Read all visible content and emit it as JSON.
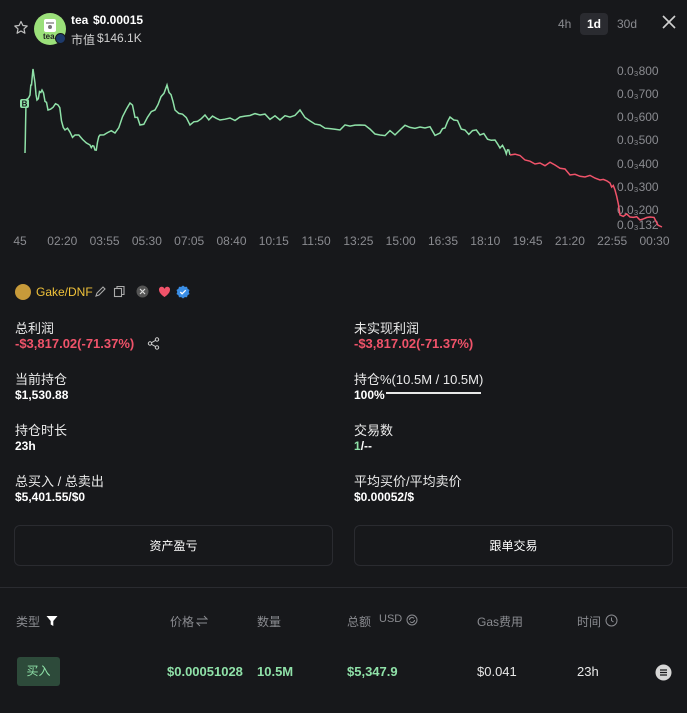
{
  "token": {
    "name": "tea",
    "price": "$0.00015",
    "market_cap_label": "市值",
    "market_cap": "$146.1K",
    "avatar_text": "tea"
  },
  "timeframes": [
    "4h",
    "1d",
    "30d"
  ],
  "active_timeframe": "1d",
  "chart_data": {
    "type": "line",
    "x_ticks": [
      "45",
      "02:20",
      "03:55",
      "05:30",
      "07:05",
      "08:40",
      "10:15",
      "11:50",
      "13:25",
      "15:00",
      "16:35",
      "18:10",
      "19:45",
      "21:20",
      "22:55",
      "00:30"
    ],
    "y_ticks": [
      "0.0₃800",
      "0.0₃700",
      "0.0₃600",
      "0.0₃500",
      "0.0₃400",
      "0.0₃300",
      "0.0₃200",
      "0.0₃132"
    ],
    "ylim": [
      0.000132,
      0.0008
    ],
    "marker": "B",
    "colors": {
      "up": "#8fe1a8",
      "down": "#f0536a"
    }
  },
  "wallet": {
    "name": "Gake/DNF"
  },
  "stats": {
    "total_profit_label": "总利润",
    "total_profit": "-$3,817.02(-71.37%)",
    "unrealized_label": "未实现利润",
    "unrealized": "-$3,817.02(-71.37%)",
    "holding_label": "当前持仓",
    "holding": "$1,530.88",
    "holding_pct_label": "持仓%(10.5M / 10.5M)",
    "holding_pct": "100%",
    "holding_fraction": 1.0,
    "duration_label": "持仓时长",
    "duration": "23h",
    "trades_label": "交易数",
    "trades_buy": "1",
    "trades_sell": "/--",
    "buy_sell_label": "总买入 / 总卖出",
    "buy_sell": "$5,401.55/$0",
    "avg_label": "平均买价/平均卖价",
    "avg": "$0.00052/$"
  },
  "buttons": {
    "pnl": "资产盈亏",
    "copy_trade": "跟单交易"
  },
  "table": {
    "headers": {
      "type": "类型",
      "price": "价格",
      "amount": "数量",
      "total": "总额",
      "total_unit": "USD",
      "gas": "Gas费用",
      "time": "时间"
    },
    "rows": [
      {
        "type": "买入",
        "price": "$0.00051028",
        "amount": "10.5M",
        "total": "$5,347.9",
        "gas": "$0.041",
        "time": "23h"
      }
    ]
  }
}
